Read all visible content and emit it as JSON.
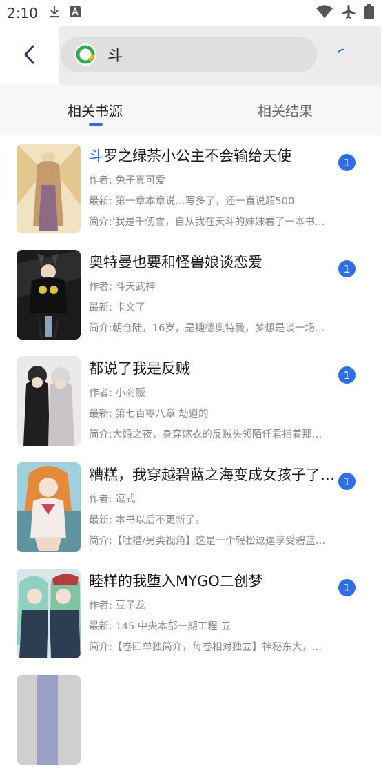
{
  "status_bar": {
    "time": "2:10",
    "left_icons": [
      "download-icon",
      "font-app-icon"
    ],
    "right_icons": [
      "wifi-icon",
      "airplane-icon",
      "battery-icon"
    ]
  },
  "search": {
    "query": "斗",
    "app_icon": "legado-app-icon"
  },
  "tabs": [
    {
      "label": "相关书源",
      "active": true
    },
    {
      "label": "相关结果",
      "active": false
    }
  ],
  "accent_color": "#2f6fe4",
  "books": [
    {
      "title_highlight": "斗",
      "title_rest": "罗之绿茶小公主不会输给天使",
      "author": "作者: 兔子真可爱",
      "latest": "最新: 第一章本章说…写多了，还一直说超500",
      "intro": "简介:'我是千仞雪，自从我在天斗的妹妹看了一本书…",
      "badge": "1",
      "cover_colors": [
        "#d8c08a",
        "#b48a5a",
        "#f3e6c8"
      ]
    },
    {
      "title_highlight": "",
      "title_rest": "奥特曼也要和怪兽娘谈恋爱",
      "author": "作者: 斗天武神",
      "latest": "最新: 卡文了",
      "intro": "简介:朝仓陆，16岁，是捷德奥特曼，梦想是谈一场…",
      "badge": "1",
      "cover_colors": [
        "#1a1a1a",
        "#3a3a3a",
        "#d4c04a"
      ]
    },
    {
      "title_highlight": "",
      "title_rest": "都说了我是反贼",
      "author": "作者: 小商贩",
      "latest": "最新: 第七百零八章 劫道的",
      "intro": "简介:大婚之夜，身穿嫁衣的反贼头领陌仟君指着那…",
      "badge": "1",
      "cover_colors": [
        "#e8e4e4",
        "#bfb8bc",
        "#2a2a2a"
      ],
      "cover_text": "都说了我是反贼"
    },
    {
      "title_highlight": "",
      "title_rest": "糟糕，我穿越碧蓝之海变成女孩子了…",
      "author": "作者: 逗式",
      "latest": "最新: 本书以后不更新了。",
      "intro": "简介:【吐槽/另类视角】这是一个轻松逗逼享受碧蓝…",
      "badge": "1",
      "cover_colors": [
        "#8fc6d6",
        "#e08a3c",
        "#f0e4d8"
      ]
    },
    {
      "title_highlight": "",
      "title_rest": "睦样的我堕入MYGO二创梦",
      "author": "作者: 豆子龙",
      "latest": "最新: 145 中央本部一期工程 五",
      "intro": "简介:【卷四单独简介，每卷相对独立】神秘东大，…",
      "badge": "1",
      "cover_colors": [
        "#8fd0c0",
        "#3a4a5a",
        "#b43c3c"
      ]
    }
  ]
}
